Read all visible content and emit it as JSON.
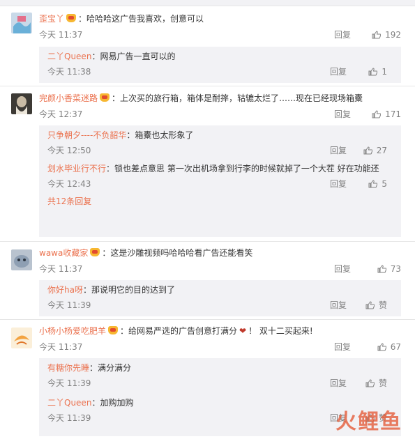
{
  "comments": [
    {
      "user": "歪宝丫",
      "text": "哈哈哈这广告我喜欢，创意可以",
      "time": "今天 11:37",
      "reply": "回复",
      "likes": "192",
      "avatar_color": "#6ab0d8",
      "replies": [
        {
          "user": "二丫Queen",
          "text": "网易广告一直可以的",
          "time": "今天 11:38",
          "reply": "回复",
          "likes": "1"
        }
      ]
    },
    {
      "user": "完颜小香菜迷路",
      "text": "上次买的旅行箱，箱体是耐摔，轱辘太烂了……现在已经现场箱櫜",
      "time": "今天 12:37",
      "reply": "回复",
      "likes": "171",
      "avatar_color": "#6d6356",
      "replies": [
        {
          "user": "只争朝夕----不负韶华",
          "text": "箱櫜也太形象了",
          "time": "今天 12:50",
          "reply": "回复",
          "likes": "27"
        },
        {
          "user": "划水毕业行不行",
          "text": "锁也差点意思 第一次出机场拿到行李的时候就掉了一个大茬  好在功能还在。",
          "time": "今天 12:43",
          "reply": "回复",
          "likes": "5"
        }
      ],
      "more": "共12条回复"
    },
    {
      "user": "wawa收藏家",
      "text": "这是沙雕视频吗哈哈哈看广告还能看笑",
      "time": "今天 11:37",
      "reply": "回复",
      "likes": "73",
      "avatar_color": "#8e9fb3",
      "replies": [
        {
          "user": "你好ha呀",
          "text": "那说明它的目的达到了",
          "time": "今天 11:39",
          "reply": "回复",
          "likes": "赞"
        }
      ]
    },
    {
      "user": "小杨小杨爱吃肥羊",
      "text": "给网易严选的广告创意打满分",
      "text2": "！ 双十二买起来!",
      "time": "今天 11:37",
      "reply": "回复",
      "likes": "67",
      "avatar_color": "#f3a340",
      "replies": [
        {
          "user": "有糖你先睡",
          "text": "满分满分",
          "time": "今天 11:39",
          "reply": "回复",
          "likes": "赞"
        },
        {
          "user": "二丫Queen",
          "text": "加购加购",
          "time": "今天 11:39",
          "reply": "回复",
          "likes": "赞"
        }
      ]
    }
  ],
  "watermark": "火鲤鱼"
}
